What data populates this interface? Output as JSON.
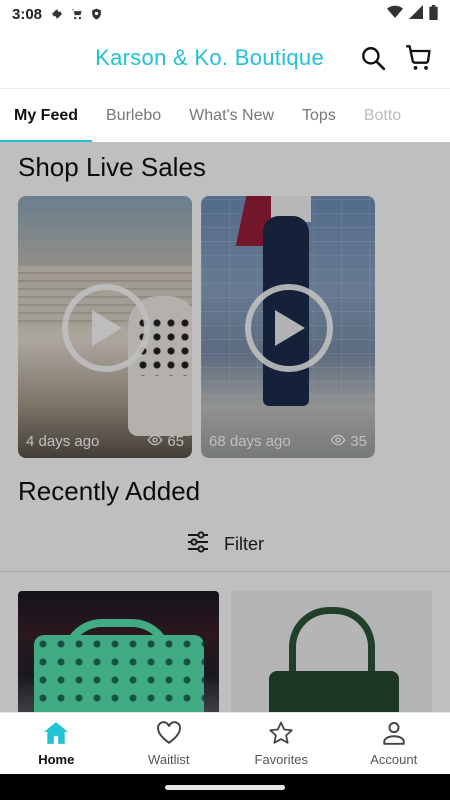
{
  "status_bar": {
    "time": "3:08",
    "left_icons": [
      "gear-icon",
      "cart-icon",
      "shield-icon"
    ],
    "right_icons": [
      "wifi-icon",
      "signal-icon",
      "battery-icon"
    ]
  },
  "app_bar": {
    "title": "Karson & Ko. Boutique",
    "brand_color": "#21c2d4",
    "actions": [
      "search-icon",
      "cart-icon"
    ]
  },
  "tabs": [
    {
      "label": "My Feed",
      "active": true
    },
    {
      "label": "Burlebo",
      "active": false
    },
    {
      "label": "What's New",
      "active": false
    },
    {
      "label": "Tops",
      "active": false
    },
    {
      "label": "Botto",
      "active": false
    }
  ],
  "live_sales": {
    "title": "Shop Live Sales",
    "videos": [
      {
        "age": "4 days ago",
        "views": "65"
      },
      {
        "age": "68 days ago",
        "views": "35"
      }
    ]
  },
  "recently_added": {
    "title": "Recently Added",
    "filter_label": "Filter"
  },
  "bottom_nav": [
    {
      "label": "Home",
      "icon": "home-icon",
      "active": true
    },
    {
      "label": "Waitlist",
      "icon": "heart-icon",
      "active": false
    },
    {
      "label": "Favorites",
      "icon": "star-icon",
      "active": false
    },
    {
      "label": "Account",
      "icon": "account-icon",
      "active": false
    }
  ]
}
